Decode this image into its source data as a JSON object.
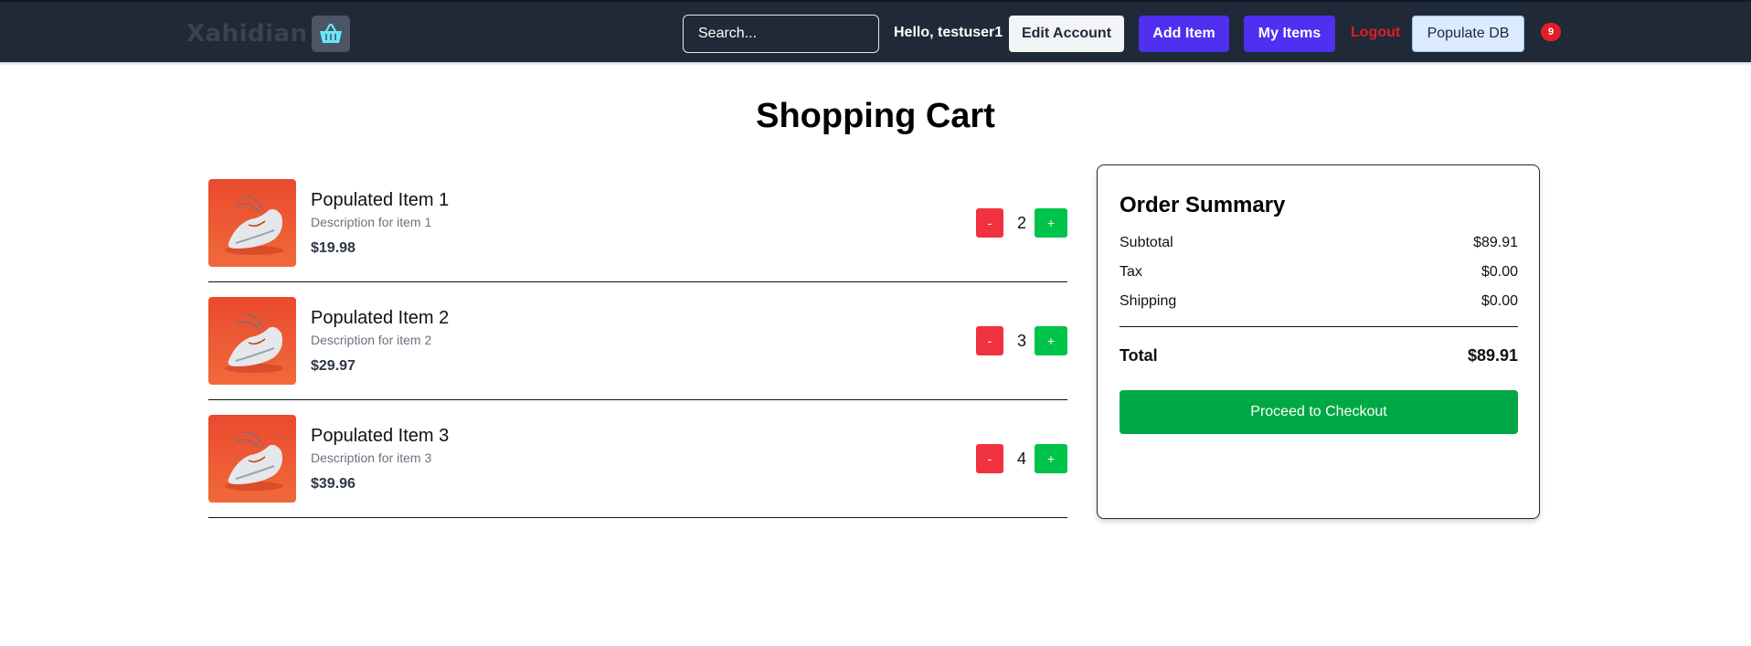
{
  "header": {
    "logo_text": "Xahidian",
    "search": {
      "placeholder": "Search..."
    },
    "greeting": "Hello, testuser1",
    "edit_account_label": "Edit Account",
    "add_item_label": "Add Item",
    "my_items_label": "My Items",
    "logout_label": "Logout",
    "populate_db_label": "Populate DB",
    "cart_count": "9"
  },
  "page": {
    "title": "Shopping Cart"
  },
  "cart": {
    "items": [
      {
        "name": "Populated Item 1",
        "description": "Description for item 1",
        "price": "$19.98",
        "quantity": "2",
        "minus_label": "-",
        "plus_label": "+"
      },
      {
        "name": "Populated Item 2",
        "description": "Description for item 2",
        "price": "$29.97",
        "quantity": "3",
        "minus_label": "-",
        "plus_label": "+"
      },
      {
        "name": "Populated Item 3",
        "description": "Description for item 3",
        "price": "$39.96",
        "quantity": "4",
        "minus_label": "-",
        "plus_label": "+"
      }
    ]
  },
  "summary": {
    "title": "Order Summary",
    "subtotal_label": "Subtotal",
    "subtotal_value": "$89.91",
    "tax_label": "Tax",
    "tax_value": "$0.00",
    "shipping_label": "Shipping",
    "shipping_value": "$0.00",
    "total_label": "Total",
    "total_value": "$89.91",
    "checkout_label": "Proceed to Checkout"
  },
  "colors": {
    "navbar_bg": "#1f2937",
    "accent_purple": "#4f2ff0",
    "logout_red": "#e11d2a",
    "minus_red": "#f0313f",
    "plus_green": "#00c34a",
    "checkout_green": "#00a845",
    "logo_basket": "#67e8f9"
  }
}
